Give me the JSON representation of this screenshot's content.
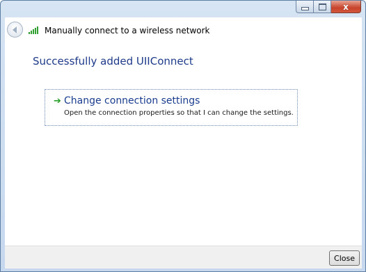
{
  "window": {
    "title": "Manually connect to a wireless network",
    "min_icon": "minimize-icon",
    "max_icon": "maximize-icon",
    "close_icon": "close-icon",
    "close_glyph": "x"
  },
  "main": {
    "heading": "Successfully added UIIConnect",
    "command_link": {
      "title": "Change connection settings",
      "description": "Open the connection properties so that I can change the settings."
    }
  },
  "footer": {
    "close_label": "Close"
  },
  "colors": {
    "heading_blue": "#1e3a8a",
    "link_blue": "#1a3c8f",
    "arrow_green": "#2a9d2a",
    "wifi_green": "#2fa02f"
  }
}
